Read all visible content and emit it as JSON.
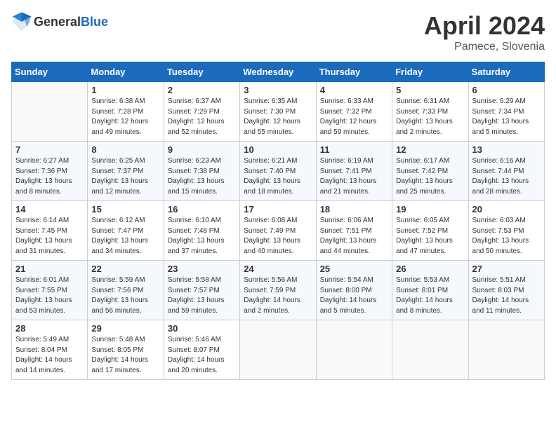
{
  "header": {
    "logo_general": "General",
    "logo_blue": "Blue",
    "month": "April 2024",
    "location": "Pamece, Slovenia"
  },
  "weekdays": [
    "Sunday",
    "Monday",
    "Tuesday",
    "Wednesday",
    "Thursday",
    "Friday",
    "Saturday"
  ],
  "weeks": [
    [
      {
        "day": "",
        "empty": true
      },
      {
        "day": "1",
        "sunrise": "Sunrise: 6:38 AM",
        "sunset": "Sunset: 7:28 PM",
        "daylight": "Daylight: 12 hours and 49 minutes."
      },
      {
        "day": "2",
        "sunrise": "Sunrise: 6:37 AM",
        "sunset": "Sunset: 7:29 PM",
        "daylight": "Daylight: 12 hours and 52 minutes."
      },
      {
        "day": "3",
        "sunrise": "Sunrise: 6:35 AM",
        "sunset": "Sunset: 7:30 PM",
        "daylight": "Daylight: 12 hours and 55 minutes."
      },
      {
        "day": "4",
        "sunrise": "Sunrise: 6:33 AM",
        "sunset": "Sunset: 7:32 PM",
        "daylight": "Daylight: 12 hours and 59 minutes."
      },
      {
        "day": "5",
        "sunrise": "Sunrise: 6:31 AM",
        "sunset": "Sunset: 7:33 PM",
        "daylight": "Daylight: 13 hours and 2 minutes."
      },
      {
        "day": "6",
        "sunrise": "Sunrise: 6:29 AM",
        "sunset": "Sunset: 7:34 PM",
        "daylight": "Daylight: 13 hours and 5 minutes."
      }
    ],
    [
      {
        "day": "7",
        "sunrise": "Sunrise: 6:27 AM",
        "sunset": "Sunset: 7:36 PM",
        "daylight": "Daylight: 13 hours and 8 minutes."
      },
      {
        "day": "8",
        "sunrise": "Sunrise: 6:25 AM",
        "sunset": "Sunset: 7:37 PM",
        "daylight": "Daylight: 13 hours and 12 minutes."
      },
      {
        "day": "9",
        "sunrise": "Sunrise: 6:23 AM",
        "sunset": "Sunset: 7:38 PM",
        "daylight": "Daylight: 13 hours and 15 minutes."
      },
      {
        "day": "10",
        "sunrise": "Sunrise: 6:21 AM",
        "sunset": "Sunset: 7:40 PM",
        "daylight": "Daylight: 13 hours and 18 minutes."
      },
      {
        "day": "11",
        "sunrise": "Sunrise: 6:19 AM",
        "sunset": "Sunset: 7:41 PM",
        "daylight": "Daylight: 13 hours and 21 minutes."
      },
      {
        "day": "12",
        "sunrise": "Sunrise: 6:17 AM",
        "sunset": "Sunset: 7:42 PM",
        "daylight": "Daylight: 13 hours and 25 minutes."
      },
      {
        "day": "13",
        "sunrise": "Sunrise: 6:16 AM",
        "sunset": "Sunset: 7:44 PM",
        "daylight": "Daylight: 13 hours and 28 minutes."
      }
    ],
    [
      {
        "day": "14",
        "sunrise": "Sunrise: 6:14 AM",
        "sunset": "Sunset: 7:45 PM",
        "daylight": "Daylight: 13 hours and 31 minutes."
      },
      {
        "day": "15",
        "sunrise": "Sunrise: 6:12 AM",
        "sunset": "Sunset: 7:47 PM",
        "daylight": "Daylight: 13 hours and 34 minutes."
      },
      {
        "day": "16",
        "sunrise": "Sunrise: 6:10 AM",
        "sunset": "Sunset: 7:48 PM",
        "daylight": "Daylight: 13 hours and 37 minutes."
      },
      {
        "day": "17",
        "sunrise": "Sunrise: 6:08 AM",
        "sunset": "Sunset: 7:49 PM",
        "daylight": "Daylight: 13 hours and 40 minutes."
      },
      {
        "day": "18",
        "sunrise": "Sunrise: 6:06 AM",
        "sunset": "Sunset: 7:51 PM",
        "daylight": "Daylight: 13 hours and 44 minutes."
      },
      {
        "day": "19",
        "sunrise": "Sunrise: 6:05 AM",
        "sunset": "Sunset: 7:52 PM",
        "daylight": "Daylight: 13 hours and 47 minutes."
      },
      {
        "day": "20",
        "sunrise": "Sunrise: 6:03 AM",
        "sunset": "Sunset: 7:53 PM",
        "daylight": "Daylight: 13 hours and 50 minutes."
      }
    ],
    [
      {
        "day": "21",
        "sunrise": "Sunrise: 6:01 AM",
        "sunset": "Sunset: 7:55 PM",
        "daylight": "Daylight: 13 hours and 53 minutes."
      },
      {
        "day": "22",
        "sunrise": "Sunrise: 5:59 AM",
        "sunset": "Sunset: 7:56 PM",
        "daylight": "Daylight: 13 hours and 56 minutes."
      },
      {
        "day": "23",
        "sunrise": "Sunrise: 5:58 AM",
        "sunset": "Sunset: 7:57 PM",
        "daylight": "Daylight: 13 hours and 59 minutes."
      },
      {
        "day": "24",
        "sunrise": "Sunrise: 5:56 AM",
        "sunset": "Sunset: 7:59 PM",
        "daylight": "Daylight: 14 hours and 2 minutes."
      },
      {
        "day": "25",
        "sunrise": "Sunrise: 5:54 AM",
        "sunset": "Sunset: 8:00 PM",
        "daylight": "Daylight: 14 hours and 5 minutes."
      },
      {
        "day": "26",
        "sunrise": "Sunrise: 5:53 AM",
        "sunset": "Sunset: 8:01 PM",
        "daylight": "Daylight: 14 hours and 8 minutes."
      },
      {
        "day": "27",
        "sunrise": "Sunrise: 5:51 AM",
        "sunset": "Sunset: 8:03 PM",
        "daylight": "Daylight: 14 hours and 11 minutes."
      }
    ],
    [
      {
        "day": "28",
        "sunrise": "Sunrise: 5:49 AM",
        "sunset": "Sunset: 8:04 PM",
        "daylight": "Daylight: 14 hours and 14 minutes."
      },
      {
        "day": "29",
        "sunrise": "Sunrise: 5:48 AM",
        "sunset": "Sunset: 8:05 PM",
        "daylight": "Daylight: 14 hours and 17 minutes."
      },
      {
        "day": "30",
        "sunrise": "Sunrise: 5:46 AM",
        "sunset": "Sunset: 8:07 PM",
        "daylight": "Daylight: 14 hours and 20 minutes."
      },
      {
        "day": "",
        "empty": true
      },
      {
        "day": "",
        "empty": true
      },
      {
        "day": "",
        "empty": true
      },
      {
        "day": "",
        "empty": true
      }
    ]
  ]
}
